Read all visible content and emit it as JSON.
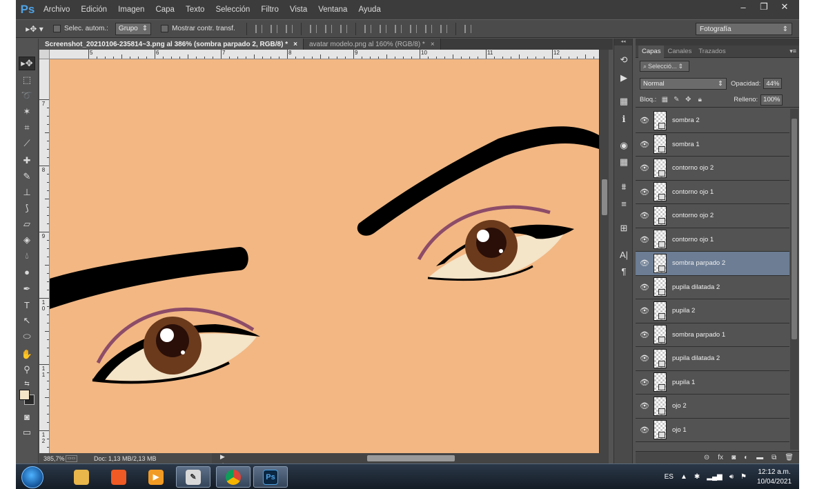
{
  "app": {
    "logo": "Ps"
  },
  "menu": [
    "Archivo",
    "Edición",
    "Imagen",
    "Capa",
    "Texto",
    "Selección",
    "Filtro",
    "Vista",
    "Ventana",
    "Ayuda"
  ],
  "window_controls": {
    "minimize": "–",
    "restore": "❐",
    "close": "✕"
  },
  "options_bar": {
    "auto_select_label": "Selec. autom.:",
    "auto_select_value": "Grupo",
    "transform_label": "Mostrar contr. transf.",
    "workspace": "Fotografía"
  },
  "documents": [
    {
      "title": "Screenshot_20210106-235814~3.png al 386% (sombra parpado 2, RGB/8) *",
      "close": "×",
      "active": true
    },
    {
      "title": "avatar modelo.png al 160% (RGB/8) *",
      "close": "×",
      "active": false
    }
  ],
  "ruler": {
    "top": [
      "5",
      "6",
      "7",
      "8",
      "9",
      "10",
      "11",
      "12"
    ],
    "left": [
      "7",
      "8",
      "9",
      "1 0",
      "1 1",
      "1 2"
    ]
  },
  "status": {
    "zoom": "385,7%",
    "doc": "Doc: 1,13 MB/2,13 MB"
  },
  "layers_panel": {
    "tabs": [
      "Capas",
      "Canales",
      "Trazados"
    ],
    "filter_placeholder": "Selecció...",
    "blend_mode": "Normal",
    "opacity_label": "Opacidad:",
    "opacity": "44%",
    "lock_label": "Bloq.:",
    "fill_label": "Relleno:",
    "fill": "100%",
    "layers": [
      {
        "name": "sombra 2",
        "selected": false
      },
      {
        "name": "sombra 1",
        "selected": false
      },
      {
        "name": "contorno ojo 2",
        "selected": false
      },
      {
        "name": "contorno ojo 1",
        "selected": false
      },
      {
        "name": "contorno ojo 2",
        "selected": false
      },
      {
        "name": "contorno ojo 1",
        "selected": false
      },
      {
        "name": "sombra parpado 2",
        "selected": true
      },
      {
        "name": "pupila dilatada 2",
        "selected": false
      },
      {
        "name": "pupila 2",
        "selected": false
      },
      {
        "name": "sombra parpado 1",
        "selected": false
      },
      {
        "name": "pupila dilatada 2",
        "selected": false
      },
      {
        "name": "pupila 1",
        "selected": false
      },
      {
        "name": "ojo 2",
        "selected": false
      },
      {
        "name": "ojo 1",
        "selected": false
      }
    ]
  },
  "taskbar": {
    "language": "ES",
    "time": "12:12 a.m.",
    "date": "10/04/2021",
    "ps_label": "Ps"
  },
  "colors": {
    "canvas_skin": "#f2b783",
    "brow": "#000000",
    "iris": "#6b3a1c",
    "eyelid_shadow": "#7b3a64",
    "selected_layer": "#6c7d94"
  }
}
